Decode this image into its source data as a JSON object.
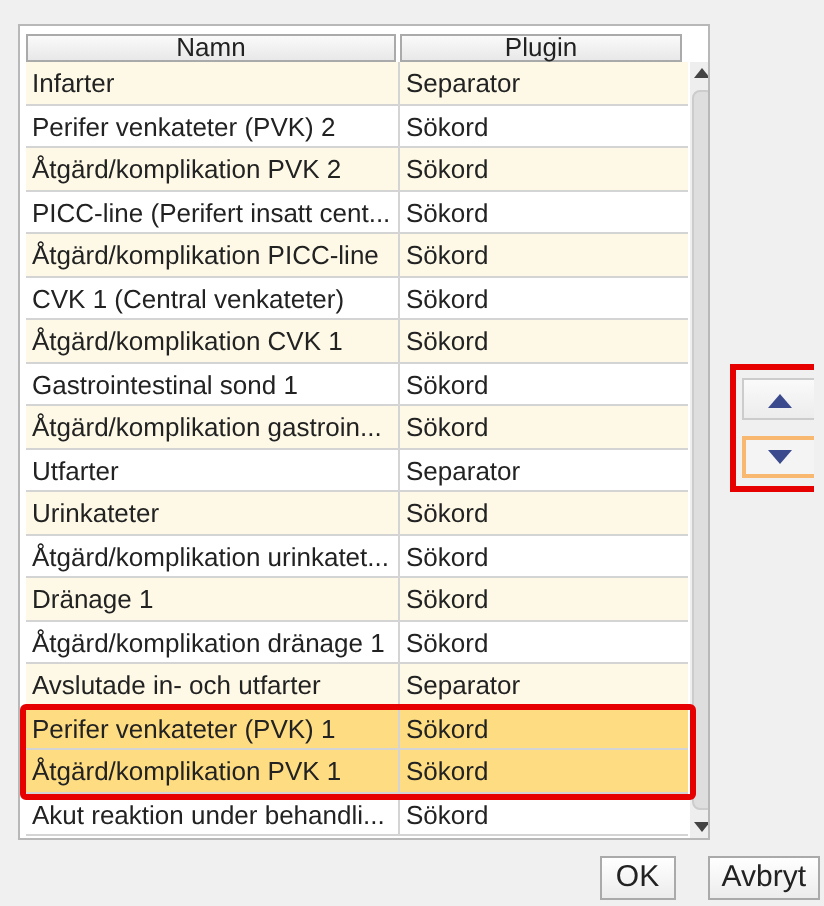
{
  "table": {
    "columns": [
      "Namn",
      "Plugin"
    ],
    "rows": [
      {
        "name": "Infarter",
        "plugin": "Separator",
        "selected": false
      },
      {
        "name": "Perifer venkateter (PVK) 2",
        "plugin": "Sökord",
        "selected": false
      },
      {
        "name": "Åtgärd/komplikation PVK 2",
        "plugin": "Sökord",
        "selected": false
      },
      {
        "name": "PICC-line (Perifert insatt cent...",
        "plugin": "Sökord",
        "selected": false
      },
      {
        "name": "Åtgärd/komplikation PICC-line",
        "plugin": "Sökord",
        "selected": false
      },
      {
        "name": "CVK 1 (Central venkateter)",
        "plugin": "Sökord",
        "selected": false
      },
      {
        "name": "Åtgärd/komplikation CVK 1",
        "plugin": "Sökord",
        "selected": false
      },
      {
        "name": "Gastrointestinal sond 1",
        "plugin": "Sökord",
        "selected": false
      },
      {
        "name": "Åtgärd/komplikation gastroin...",
        "plugin": "Sökord",
        "selected": false
      },
      {
        "name": "Utfarter",
        "plugin": "Separator",
        "selected": false
      },
      {
        "name": "Urinkateter",
        "plugin": "Sökord",
        "selected": false
      },
      {
        "name": "Åtgärd/komplikation urinkatet...",
        "plugin": "Sökord",
        "selected": false
      },
      {
        "name": "Dränage 1",
        "plugin": "Sökord",
        "selected": false
      },
      {
        "name": "Åtgärd/komplikation dränage 1",
        "plugin": "Sökord",
        "selected": false
      },
      {
        "name": "Avslutade in- och utfarter",
        "plugin": "Separator",
        "selected": false
      },
      {
        "name": "Perifer venkateter (PVK) 1",
        "plugin": "Sökord",
        "selected": true
      },
      {
        "name": "Åtgärd/komplikation PVK 1",
        "plugin": "Sökord",
        "selected": true
      },
      {
        "name": "Akut reaktion under behandli...",
        "plugin": "Sökord",
        "selected": false
      }
    ]
  },
  "move_buttons": [
    {
      "kind": "up",
      "focused": false
    },
    {
      "kind": "down",
      "focused": true
    }
  ],
  "buttons": [
    "OK",
    "Avbryt"
  ]
}
